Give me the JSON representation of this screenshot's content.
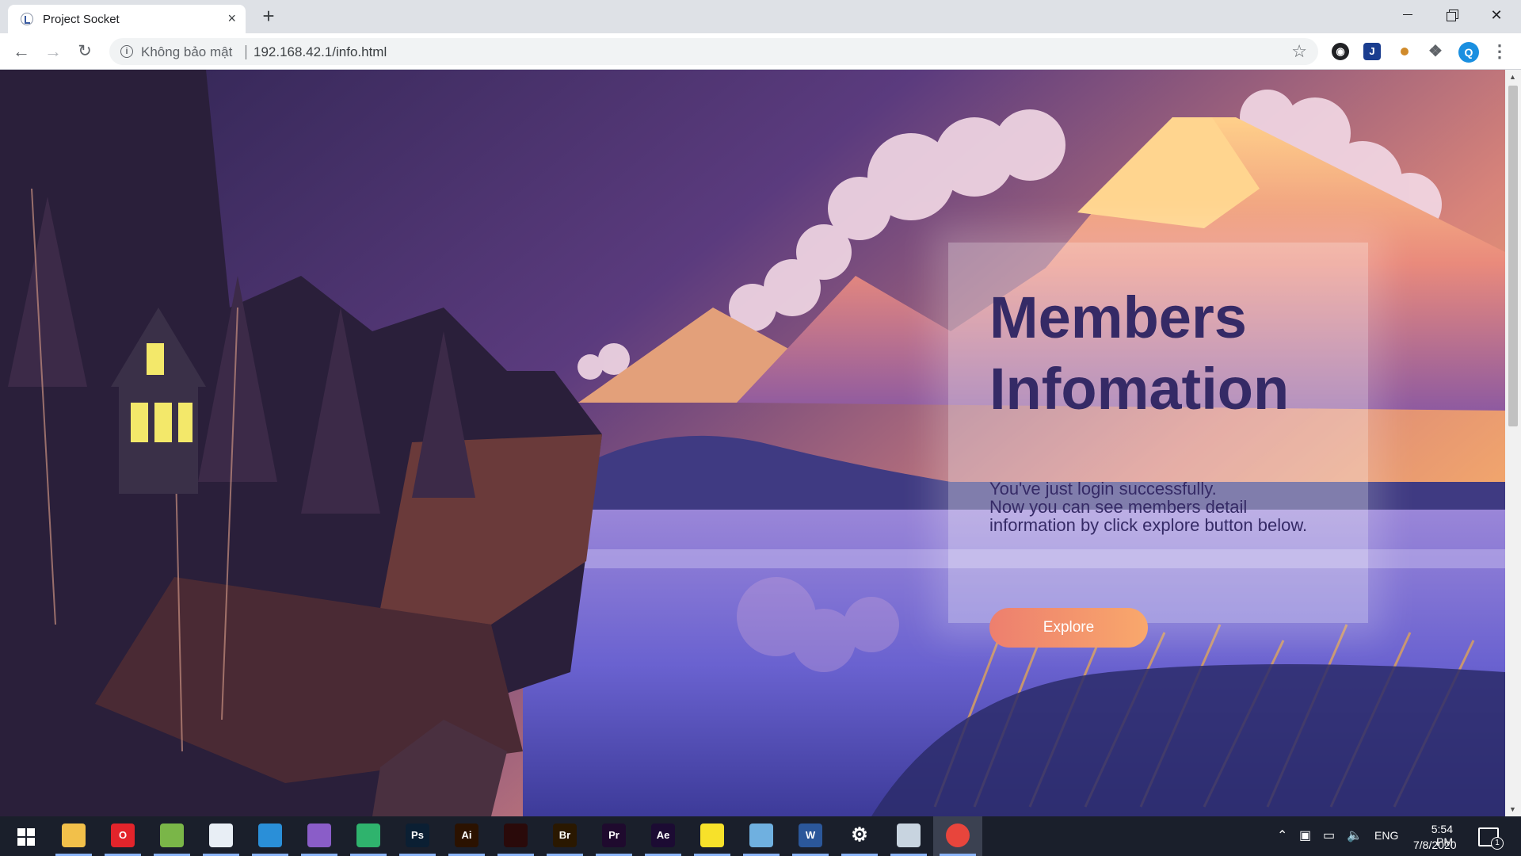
{
  "browser": {
    "tab_title": "Project Socket",
    "tab_close": "×",
    "new_tab": "+",
    "security_label": "Không bảo mật",
    "url": "192.168.42.1/info.html",
    "profile_initial": "Q"
  },
  "page": {
    "title_line1": "Members",
    "title_line2": "Infomation",
    "message_line1": "You've just login successfully.",
    "message_line2": "Now you can see members detail",
    "message_line3": "information by click explore button below.",
    "explore_label": "Explore"
  },
  "taskbar": {
    "apps": [
      {
        "name": "file-explorer-icon",
        "color": "#f2c04a",
        "label": ""
      },
      {
        "name": "opera-icon",
        "color": "#e3242b",
        "label": "O"
      },
      {
        "name": "image-viewer-icon",
        "color": "#7ab648",
        "label": ""
      },
      {
        "name": "notepad-icon",
        "color": "#e8eef5",
        "label": ""
      },
      {
        "name": "vscode-icon",
        "color": "#2a8fd8",
        "label": ""
      },
      {
        "name": "visual-studio-icon",
        "color": "#8a5dc8",
        "label": ""
      },
      {
        "name": "gitkraken-icon",
        "color": "#2fb36d",
        "label": ""
      },
      {
        "name": "photoshop-icon",
        "color": "#0b1f33",
        "label": "Ps"
      },
      {
        "name": "illustrator-icon",
        "color": "#2b1200",
        "label": "Ai"
      },
      {
        "name": "acrobat-icon",
        "color": "#2a0a0a",
        "label": ""
      },
      {
        "name": "bridge-icon",
        "color": "#2a1800",
        "label": "Br"
      },
      {
        "name": "premiere-icon",
        "color": "#1f0a2e",
        "label": "Pr"
      },
      {
        "name": "after-effects-icon",
        "color": "#1c0b33",
        "label": "Ae"
      },
      {
        "name": "sticky-notes-icon",
        "color": "#f7e12a",
        "label": ""
      },
      {
        "name": "control-panel-icon",
        "color": "#6fb0e0",
        "label": ""
      },
      {
        "name": "word-icon",
        "color": "#2b579a",
        "label": "W"
      },
      {
        "name": "settings-icon",
        "color": "transparent",
        "label": "⚙"
      },
      {
        "name": "python-icon",
        "color": "#c8d4e0",
        "label": ""
      },
      {
        "name": "chrome-icon",
        "color": "#e8453c",
        "label": ""
      }
    ],
    "language": "ENG",
    "time": "5:54 PM",
    "date": "7/8/2020",
    "notification_count": "1"
  }
}
